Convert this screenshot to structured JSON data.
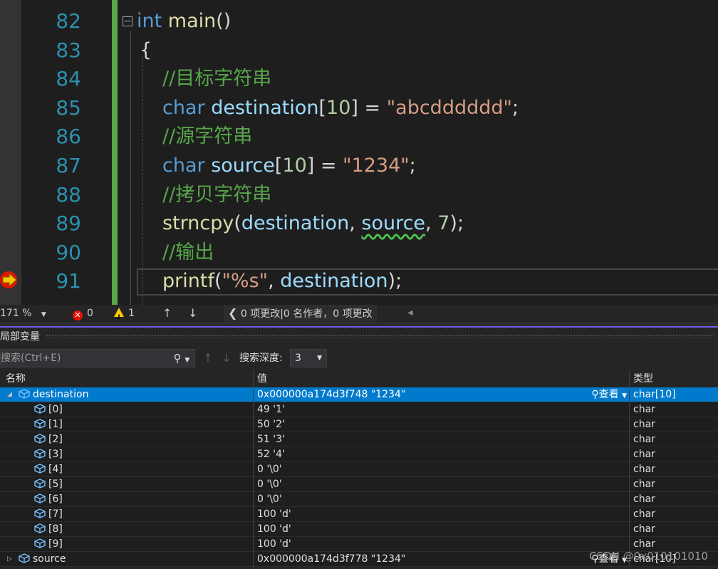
{
  "editor": {
    "lines": [
      {
        "n": "82",
        "html": "<span class='collapse-box' data-name='collapse-toggle' data-interactable='true'>&#8722;</span><span class='kw'>int</span><span class='pl'> </span><span class='fn'>main</span><span class='pl'>()</span>",
        "indent": 0
      },
      {
        "n": "83",
        "html": "<span class='pl'>{</span>",
        "indent": 24
      },
      {
        "n": "84",
        "html": "<span class='cm'>//目标字符串</span>",
        "indent": 56
      },
      {
        "n": "85",
        "html": "<span class='kw'>char</span><span class='pl'> </span><span class='var'>destination</span><span class='pl'>[</span><span class='num'>10</span><span class='pl'>] = </span><span class='str'>\"abcdddddd\"</span><span class='pl'>;</span>",
        "indent": 56
      },
      {
        "n": "86",
        "html": "<span class='cm'>//源字符串</span>",
        "indent": 56
      },
      {
        "n": "87",
        "html": "<span class='kw'>char</span><span class='pl'> </span><span class='var'>source</span><span class='pl'>[</span><span class='num'>10</span><span class='pl'>] = </span><span class='str'>\"1234\"</span><span class='pl'>;</span>",
        "indent": 56
      },
      {
        "n": "88",
        "html": "<span class='cm'>//拷贝字符串</span>",
        "indent": 56
      },
      {
        "n": "89",
        "html": "<span class='fn'>strncpy</span><span class='pl'>(</span><span class='var'>destination</span><span class='pl'>, </span><span class='var squig'>source</span><span class='pl'>, </span><span class='num'>7</span><span class='pl'>);</span>",
        "indent": 56
      },
      {
        "n": "90",
        "html": "<span class='cm'>//输出</span>",
        "indent": 56
      },
      {
        "n": "91",
        "html": "<span class='fn'>printf</span><span class='pl'>(</span><span class='str'>\"%s\"</span><span class='pl'>, </span><span class='var'>destination</span><span class='pl'>);</span>",
        "indent": 56
      }
    ]
  },
  "statusbar": {
    "zoom": "171 %",
    "errors": "0",
    "warnings": "1",
    "changes": "0 项更改|0 名作者，0 项更改"
  },
  "panel": {
    "title": "局部变量",
    "search_placeholder": "搜索(Ctrl+E)",
    "depth_label": "搜索深度:",
    "depth_value": "3",
    "columns": {
      "name": "名称",
      "value": "值",
      "type": "类型"
    }
  },
  "locals": [
    {
      "name": "destination",
      "value": "0x000000a174d3f748 \"1234\"",
      "type": "char[10]",
      "level": 0,
      "expanded": true,
      "selected": true,
      "view": "查看"
    },
    {
      "name": "[0]",
      "value": "49 '1'",
      "type": "char",
      "level": 1
    },
    {
      "name": "[1]",
      "value": "50 '2'",
      "type": "char",
      "level": 1
    },
    {
      "name": "[2]",
      "value": "51 '3'",
      "type": "char",
      "level": 1
    },
    {
      "name": "[3]",
      "value": "52 '4'",
      "type": "char",
      "level": 1
    },
    {
      "name": "[4]",
      "value": "0 '\\0'",
      "type": "char",
      "level": 1
    },
    {
      "name": "[5]",
      "value": "0 '\\0'",
      "type": "char",
      "level": 1
    },
    {
      "name": "[6]",
      "value": "0 '\\0'",
      "type": "char",
      "level": 1
    },
    {
      "name": "[7]",
      "value": "100 'd'",
      "type": "char",
      "level": 1
    },
    {
      "name": "[8]",
      "value": "100 'd'",
      "type": "char",
      "level": 1
    },
    {
      "name": "[9]",
      "value": "100 'd'",
      "type": "char",
      "level": 1
    },
    {
      "name": "source",
      "value": "0x000000a174d3f778 \"1234\"",
      "type": "char[10]",
      "level": 0,
      "expanded": false,
      "selected": false,
      "view": "查看"
    }
  ],
  "watermark": "CSDN @0x010101010",
  "colors": {
    "accent": "#007acc",
    "breakpoint": "#e51400",
    "changebar": "#57a64a"
  }
}
